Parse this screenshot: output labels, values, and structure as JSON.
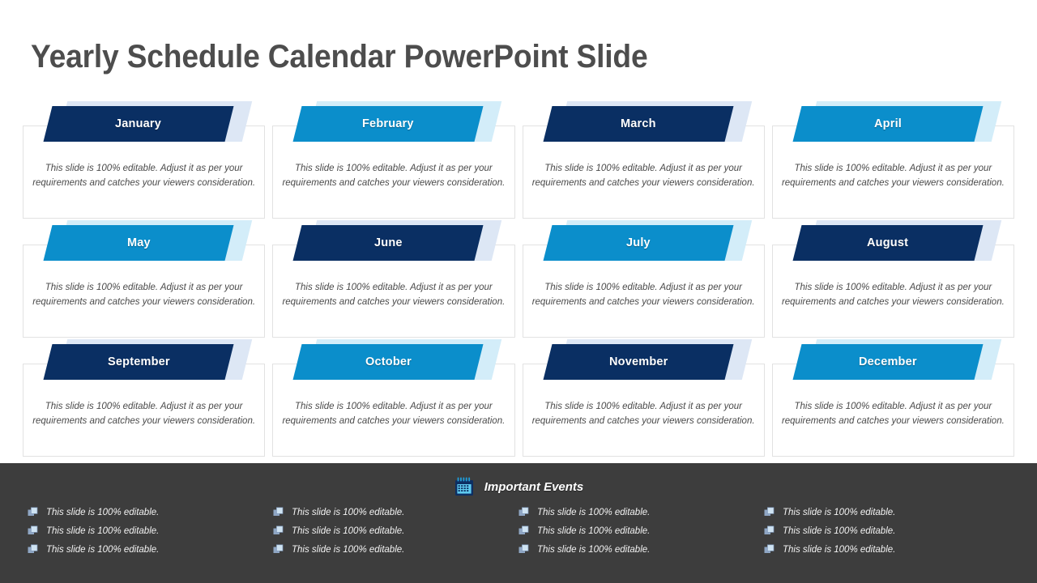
{
  "slide": {
    "title": "Yearly Schedule Calendar PowerPoint Slide",
    "body_text": "This slide is 100% editable. Adjust it as per your requirements and catches your viewers consideration.",
    "colors": {
      "navy": "#0a2f63",
      "cyan": "#0b8ecb",
      "navy_tint": "#dde7f5",
      "cyan_tint": "#d3edf9",
      "title_text": "#4d4d4d",
      "footer_background": "#3d3d3d",
      "card_border": "#e2e2e2",
      "body_text": "#4a4a4a"
    }
  },
  "months": [
    {
      "name": "January",
      "theme": "navy",
      "body": "This slide is 100% editable. Adjust it as per your requirements and catches your viewers consideration."
    },
    {
      "name": "February",
      "theme": "cyan",
      "body": "This slide is 100% editable. Adjust it as per your requirements and catches your viewers consideration."
    },
    {
      "name": "March",
      "theme": "navy",
      "body": "This slide is 100% editable. Adjust it as per your requirements and catches your viewers consideration."
    },
    {
      "name": "April",
      "theme": "cyan",
      "body": "This slide is 100% editable. Adjust it as per your requirements and catches your viewers consideration."
    },
    {
      "name": "May",
      "theme": "cyan",
      "body": "This slide is 100% editable. Adjust it as per your requirements and catches your viewers consideration."
    },
    {
      "name": "June",
      "theme": "navy",
      "body": "This slide is 100% editable. Adjust it as per your requirements and catches your viewers consideration."
    },
    {
      "name": "July",
      "theme": "cyan",
      "body": "This slide is 100% editable. Adjust it as per your requirements and catches your viewers consideration."
    },
    {
      "name": "August",
      "theme": "navy",
      "body": "This slide is 100% editable. Adjust it as per your requirements and catches your viewers consideration."
    },
    {
      "name": "September",
      "theme": "navy",
      "body": "This slide is 100% editable. Adjust it as per your requirements and catches your viewers consideration."
    },
    {
      "name": "October",
      "theme": "cyan",
      "body": "This slide is 100% editable. Adjust it as per your requirements and catches your viewers consideration."
    },
    {
      "name": "November",
      "theme": "navy",
      "body": "This slide is 100% editable. Adjust it as per your requirements and catches your viewers consideration."
    },
    {
      "name": "December",
      "theme": "cyan",
      "body": "This slide is 100% editable. Adjust it as per your requirements and catches your viewers consideration."
    }
  ],
  "footer": {
    "icon": "calendar-icon",
    "title": "Important Events",
    "bullet_icon": "stacked-squares-icon",
    "columns": [
      {
        "items": [
          "This slide is 100% editable.",
          "This slide is 100% editable.",
          "This slide is 100% editable."
        ]
      },
      {
        "items": [
          "This slide is 100% editable.",
          "This slide is 100% editable.",
          "This slide is 100% editable."
        ]
      },
      {
        "items": [
          "This slide is 100% editable.",
          "This slide is 100% editable.",
          "This slide is 100% editable."
        ]
      },
      {
        "items": [
          "This slide is 100% editable.",
          "This slide is 100% editable.",
          "This slide is 100% editable."
        ]
      }
    ]
  }
}
